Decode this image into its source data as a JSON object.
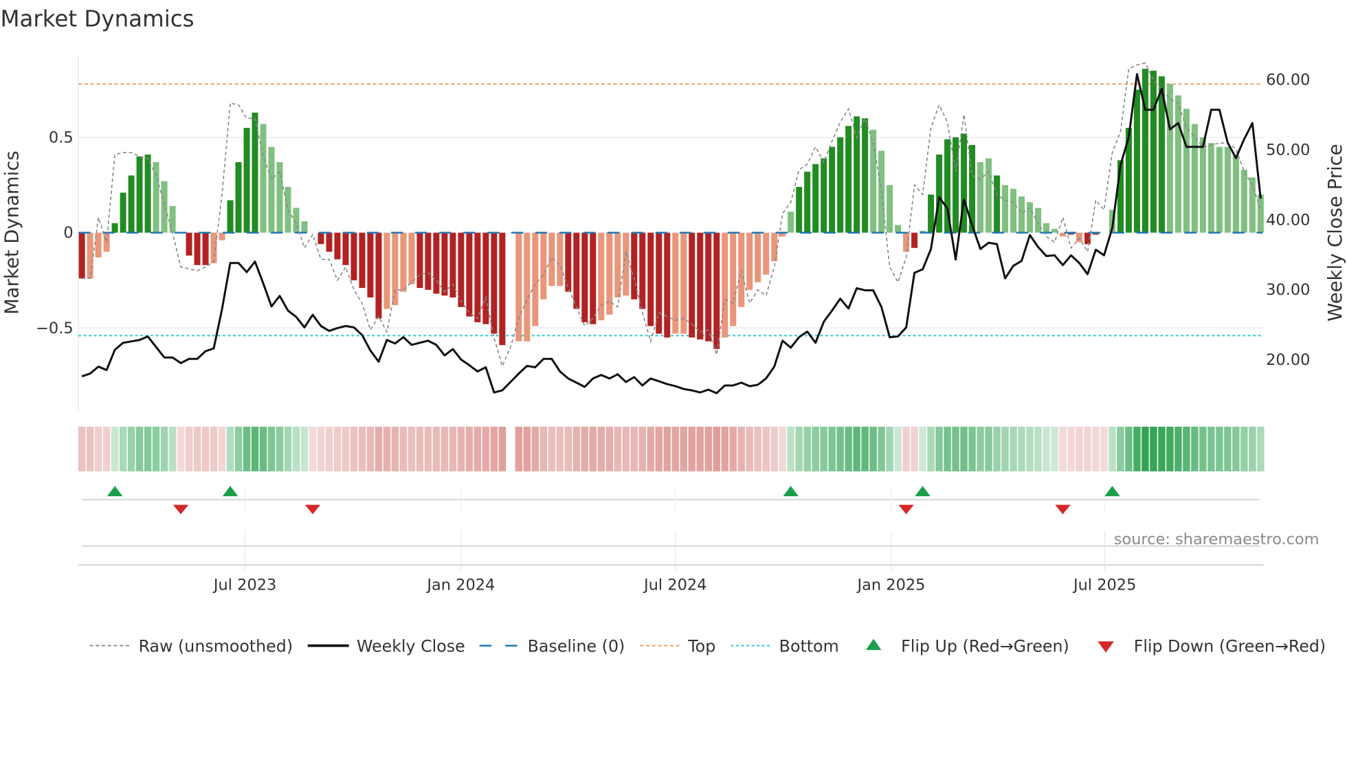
{
  "title": "Market Dynamics",
  "source": "source: sharemaestro.com",
  "colors": {
    "bull_strong": "#228b22",
    "bull_weak": "#80c080",
    "bear_strong": "#b22222",
    "bear_weak": "#e9967a",
    "close": "#111111",
    "raw": "#888888",
    "baseline": "#1f77b4",
    "top": "#f0a060",
    "bottom": "#22c5d8",
    "flip_up": "#1a9e4a",
    "flip_down": "#d62728"
  },
  "chart_data": {
    "type": "bar",
    "title": "Market Dynamics",
    "ylabel": "Market Dynamics",
    "ylabel_right": "Weekly Close Price",
    "ylim": [
      -0.93,
      0.93
    ],
    "ylim_right": [
      15.0,
      62.5
    ],
    "yticks": [
      {
        "v": 0.5,
        "label": "0.5"
      },
      {
        "v": 0,
        "label": "0"
      },
      {
        "v": -0.5,
        "label": "−0.5"
      }
    ],
    "yticks_right": [
      {
        "v": 60,
        "label": "60.00"
      },
      {
        "v": 50,
        "label": "50.00"
      },
      {
        "v": 40,
        "label": "40.00"
      },
      {
        "v": 30,
        "label": "30.00"
      },
      {
        "v": 20,
        "label": "20.00"
      }
    ],
    "x_unit": "week index",
    "xticks": [
      {
        "week": 19.8,
        "label": "Jul 2023"
      },
      {
        "week": 46.0,
        "label": "Jan 2024"
      },
      {
        "week": 72.0,
        "label": "Jul 2024"
      },
      {
        "week": 98.2,
        "label": "Jan 2025"
      },
      {
        "week": 124.1,
        "label": "Jul 2025"
      }
    ],
    "top_level": 0.78,
    "bottom_level": -0.54,
    "values": [
      -0.24,
      -0.24,
      -0.13,
      -0.1,
      0.05,
      0.21,
      0.3,
      0.4,
      0.41,
      0.37,
      0.27,
      0.14,
      0,
      -0.12,
      -0.17,
      -0.17,
      -0.16,
      -0.04,
      0.17,
      0.37,
      0.55,
      0.63,
      0.57,
      0.45,
      0.37,
      0.24,
      0.13,
      0.06,
      0,
      -0.06,
      -0.1,
      -0.14,
      -0.17,
      -0.25,
      -0.29,
      -0.34,
      -0.45,
      -0.4,
      -0.38,
      -0.31,
      -0.27,
      -0.29,
      -0.3,
      -0.32,
      -0.33,
      -0.34,
      -0.39,
      -0.44,
      -0.47,
      -0.48,
      -0.53,
      -0.59,
      null,
      -0.57,
      -0.57,
      -0.49,
      -0.35,
      -0.28,
      -0.28,
      -0.31,
      -0.4,
      -0.47,
      -0.48,
      -0.46,
      -0.43,
      -0.34,
      -0.33,
      -0.35,
      -0.4,
      -0.49,
      -0.53,
      -0.55,
      -0.53,
      -0.53,
      -0.55,
      -0.56,
      -0.57,
      -0.61,
      -0.55,
      -0.49,
      -0.39,
      -0.3,
      -0.26,
      -0.22,
      -0.15,
      -0.02,
      0.11,
      0.24,
      0.32,
      0.36,
      0.39,
      0.45,
      0.5,
      0.56,
      0.61,
      0.6,
      0.54,
      0.43,
      0.25,
      0.04,
      -0.1,
      -0.08,
      0.01,
      0.2,
      0.41,
      0.49,
      0.5,
      0.52,
      0.46,
      0.37,
      0.39,
      0.3,
      0.25,
      0.23,
      0.19,
      0.16,
      0.13,
      0.05,
      0.02,
      -0.02,
      -0.01,
      -0.05,
      -0.06,
      -0.01,
      0,
      0.12,
      0.38,
      0.55,
      0.75,
      0.86,
      0.85,
      0.82,
      0.78,
      0.72,
      0.65,
      0.57,
      0.5,
      0.47,
      0.45,
      0.45,
      0.4,
      0.33,
      0.29,
      0.2
    ],
    "bar_shade": "DLLLDDDDDLLL-DDDLLDDDDLLLLLL-DDDDDDDDLLLLDDDDDDDDDDD-LLLLLLDDDDLLLLDDDDDLLDDDDLLLLLLLLLDDDDDDDDDLLLLLDLDDDDDDLLDLLLLLLLLDLDDL-DDDDDDLLLLLLLLLLLLL",
    "raw": [
      -0.24,
      -0.24,
      0.08,
      -0.05,
      0.41,
      0.42,
      0.42,
      0.4,
      0.39,
      0.3,
      0.15,
      0.0,
      -0.18,
      -0.19,
      -0.2,
      -0.18,
      -0.15,
      0.2,
      0.68,
      0.67,
      0.6,
      0.6,
      0.4,
      0.28,
      0.32,
      0.12,
      0.05,
      -0.08,
      -0.01,
      -0.14,
      -0.14,
      -0.25,
      -0.18,
      -0.3,
      -0.37,
      -0.51,
      -0.44,
      -0.52,
      -0.3,
      -0.3,
      -0.26,
      -0.22,
      -0.21,
      -0.25,
      -0.31,
      -0.27,
      -0.36,
      -0.42,
      -0.45,
      -0.34,
      -0.55,
      -0.7,
      -0.6,
      -0.45,
      -0.35,
      -0.27,
      -0.22,
      -0.13,
      -0.17,
      -0.29,
      -0.39,
      -0.49,
      -0.45,
      -0.38,
      -0.36,
      -0.39,
      -0.1,
      -0.24,
      -0.42,
      -0.57,
      -0.42,
      -0.44,
      -0.46,
      -0.45,
      -0.48,
      -0.52,
      -0.51,
      -0.64,
      -0.35,
      -0.37,
      -0.2,
      -0.37,
      -0.3,
      -0.33,
      -0.18,
      0.1,
      0.16,
      0.33,
      0.36,
      0.45,
      0.37,
      0.48,
      0.58,
      0.65,
      0.5,
      0.6,
      0.47,
      0.22,
      -0.18,
      -0.26,
      -0.13,
      0.25,
      0.2,
      0.55,
      0.67,
      0.58,
      0.32,
      0.62,
      0.3,
      0.28,
      0.32,
      0.2,
      0.17,
      0.16,
      0.1,
      0.13,
      0.05,
      -0.02,
      -0.05,
      0.08,
      -0.08,
      -0.03,
      -0.1,
      0.17,
      0.12,
      0.42,
      0.53,
      0.86,
      0.88,
      0.89,
      0.8,
      0.75,
      0.7,
      0.68,
      0.55,
      0.5,
      0.45,
      0.46,
      0.47,
      0.47,
      0.44,
      0.32,
      0.25,
      0.12
    ],
    "close": [
      17.5,
      17.9,
      18.9,
      18.4,
      21.3,
      22.3,
      22.5,
      22.7,
      23.2,
      21.7,
      20.2,
      20.2,
      19.4,
      20.0,
      20.0,
      21.1,
      21.5,
      27.1,
      33.7,
      33.7,
      32.4,
      33.9,
      30.8,
      27.5,
      29.0,
      26.9,
      26.0,
      24.5,
      26.3,
      24.7,
      24.0,
      24.4,
      24.7,
      24.5,
      23.4,
      21.2,
      19.6,
      22.7,
      22.2,
      23.1,
      22.0,
      22.3,
      22.6,
      22.0,
      20.5,
      21.4,
      19.9,
      19.1,
      18.2,
      18.8,
      15.2,
      15.5,
      16.7,
      17.9,
      19.0,
      18.8,
      20.0,
      20.0,
      18.2,
      17.2,
      16.6,
      16.0,
      17.2,
      17.7,
      17.2,
      17.8,
      16.7,
      17.4,
      16.2,
      17.2,
      16.8,
      16.4,
      16.1,
      15.7,
      15.5,
      15.2,
      15.6,
      15.1,
      16.2,
      16.2,
      16.6,
      16.1,
      16.3,
      17.2,
      18.9,
      22.6,
      21.6,
      23.1,
      23.9,
      22.3,
      25.3,
      26.9,
      28.6,
      27.2,
      30.1,
      29.8,
      29.8,
      27.4,
      23.1,
      23.2,
      24.5,
      32.3,
      32.8,
      35.7,
      43.1,
      41.5,
      34.2,
      42.8,
      39.1,
      35.7,
      36.6,
      36.4,
      31.5,
      33.3,
      34.0,
      37.7,
      36.0,
      34.7,
      34.8,
      33.4,
      34.8,
      33.7,
      32.1,
      35.6,
      34.8,
      38.7,
      47.7,
      51.7,
      60.7,
      55.6,
      55.6,
      58.6,
      52.8,
      53.7,
      50.3,
      50.3,
      50.3,
      55.6,
      55.6,
      50.9,
      48.7,
      51.4,
      53.7,
      42.9
    ],
    "flip_up_weeks": [
      4,
      18,
      86,
      102,
      125
    ],
    "flip_down_weeks": [
      12,
      28,
      100,
      119
    ],
    "grid": true,
    "legend_position": "bottom",
    "legend": [
      {
        "label": "Raw (unsmoothed)",
        "kind": "raw"
      },
      {
        "label": "Weekly Close",
        "kind": "close"
      },
      {
        "label": "Baseline (0)",
        "kind": "baseline"
      },
      {
        "label": "Top",
        "kind": "top"
      },
      {
        "label": "Bottom",
        "kind": "bottom"
      },
      {
        "label": "Flip Up (Red→Green)",
        "kind": "up"
      },
      {
        "label": "Flip Down (Green→Red)",
        "kind": "down"
      }
    ]
  }
}
